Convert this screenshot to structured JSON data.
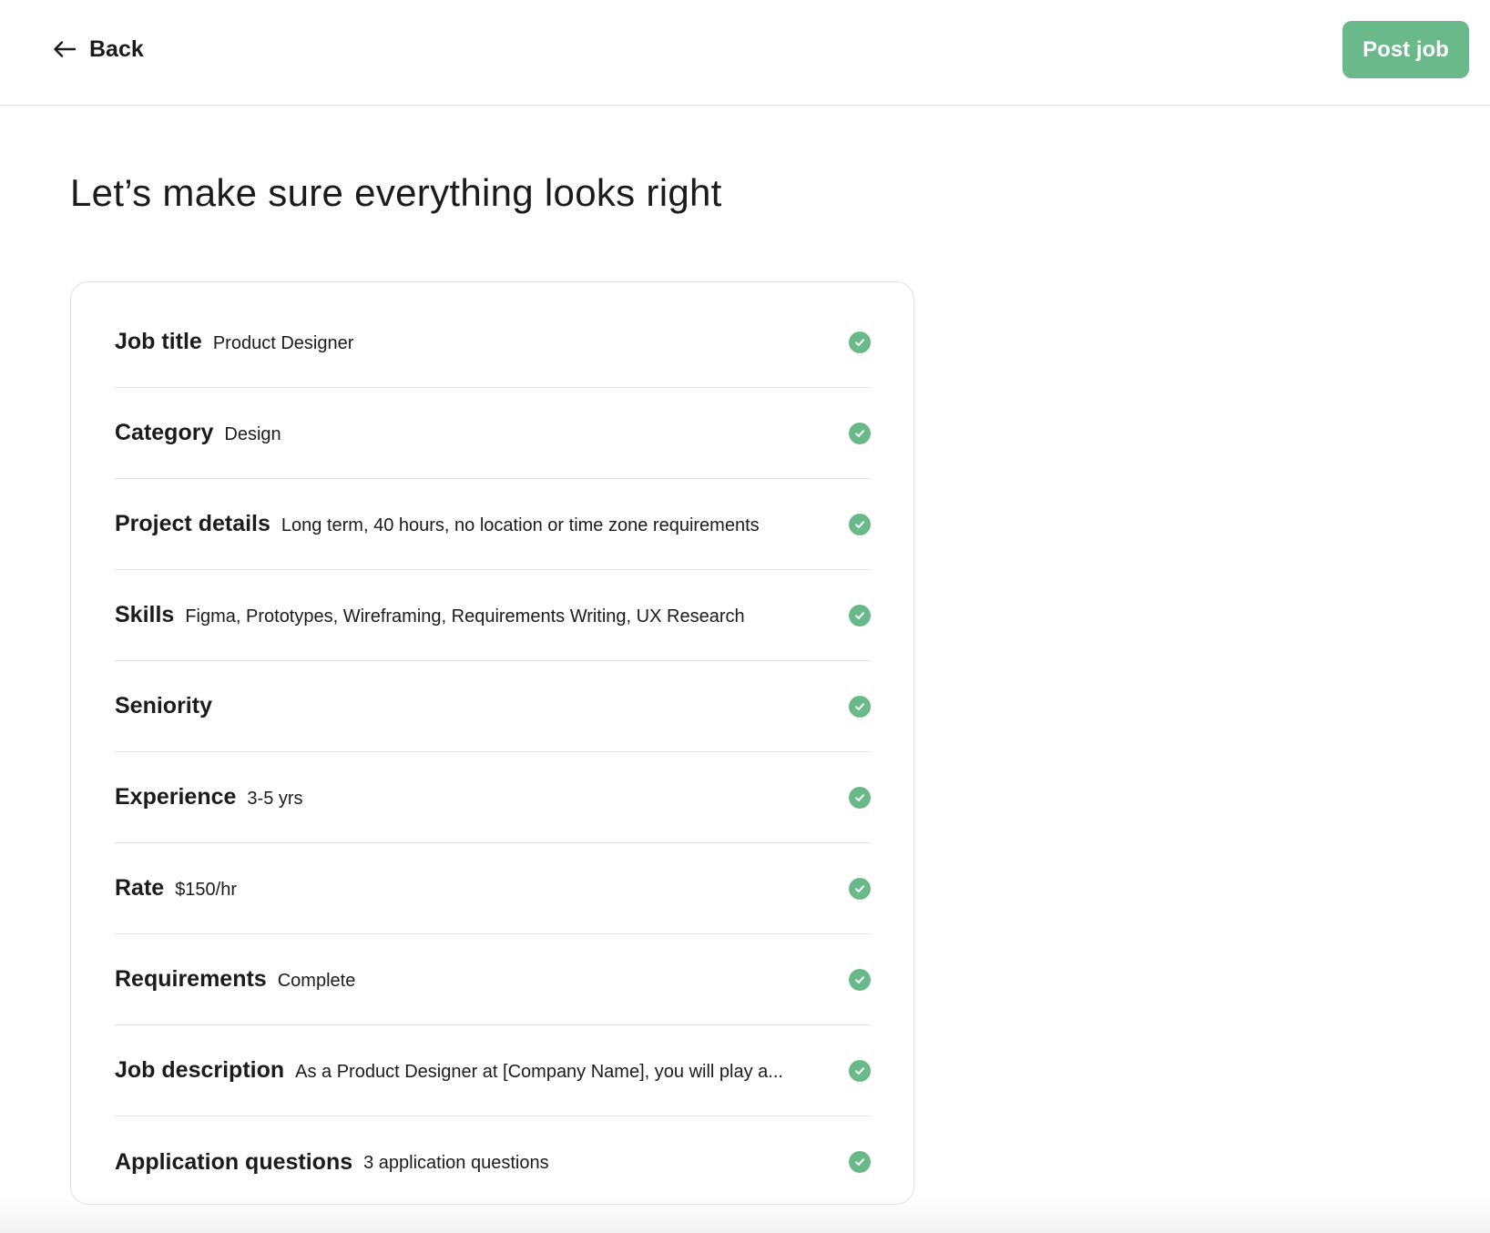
{
  "header": {
    "back_label": "Back",
    "post_label": "Post job",
    "accent_color": "#6ab98b"
  },
  "page": {
    "title": "Let’s make sure everything looks right"
  },
  "review": {
    "rows": [
      {
        "label": "Job title",
        "value": "Product Designer",
        "status": "check-circle-icon"
      },
      {
        "label": "Category",
        "value": "Design",
        "status": "check-circle-icon"
      },
      {
        "label": "Project details",
        "value": "Long term, 40 hours, no location or time zone requirements",
        "status": "check-circle-icon"
      },
      {
        "label": "Skills",
        "value": "Figma, Prototypes, Wireframing, Requirements Writing, UX Research",
        "status": "check-circle-icon"
      },
      {
        "label": "Seniority",
        "value": "",
        "status": "check-circle-icon"
      },
      {
        "label": "Experience",
        "value": "3-5 yrs",
        "status": "check-circle-icon"
      },
      {
        "label": "Rate",
        "value": "$150/hr",
        "status": "check-circle-icon"
      },
      {
        "label": "Requirements",
        "value": "Complete",
        "status": "check-circle-icon"
      },
      {
        "label": "Job description",
        "value": "As a Product Designer at [Company Name], you will play a...",
        "status": "check-circle-icon"
      },
      {
        "label": "Application questions",
        "value": "3 application questions",
        "status": "check-circle-icon"
      }
    ]
  }
}
